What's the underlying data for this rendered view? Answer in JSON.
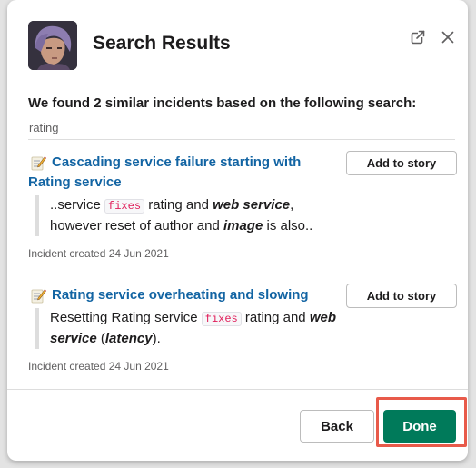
{
  "dialog": {
    "title": "Search Results",
    "intro": "We found 2 similar incidents based on the following search:",
    "query": "rating"
  },
  "icons": {
    "external": "external-link-icon",
    "close": "close-icon",
    "incident_emoji": "memo-icon"
  },
  "incidents": [
    {
      "title": "Cascading service failure starting with Rating service",
      "add_label": "Add to story",
      "snippet": {
        "t1": "..service ",
        "code": "fixes",
        "t2": " rating and ",
        "em1": "web service",
        "t3": ", however reset of author and ",
        "em2": "image",
        "t4": " is also.."
      },
      "created": "Incident created 24 Jun 2021"
    },
    {
      "title": "Rating service overheating and slowing",
      "add_label": "Add to story",
      "snippet": {
        "t1": "Resetting Rating service ",
        "code": "fixes",
        "t2": " rating and ",
        "em1": "web service",
        "t3": " (",
        "em2": "latency",
        "t4": ")."
      },
      "created": "Incident created 24 Jun 2021"
    }
  ],
  "footer": {
    "back_label": "Back",
    "done_label": "Done"
  },
  "colors": {
    "link": "#1264a3",
    "primary": "#007a5a",
    "highlight": "#e85a4a",
    "code": "#e01e5a"
  }
}
